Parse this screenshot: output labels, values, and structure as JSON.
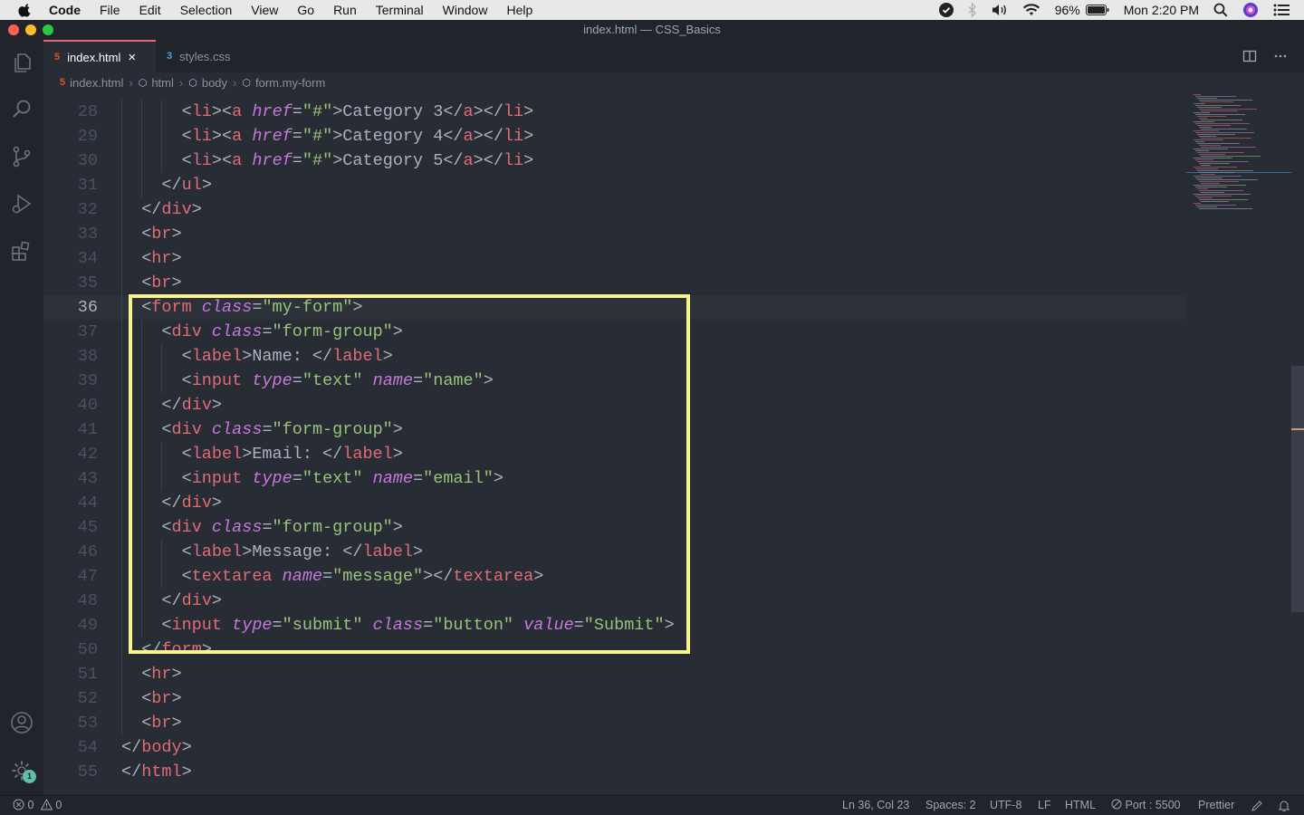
{
  "menubar": {
    "app": "Code",
    "items": [
      "File",
      "Edit",
      "Selection",
      "View",
      "Go",
      "Run",
      "Terminal",
      "Window",
      "Help"
    ],
    "battery": "96%",
    "clock": "Mon 2:20 PM"
  },
  "window": {
    "title": "index.html — CSS_Basics"
  },
  "tabs": [
    {
      "label": "index.html",
      "icon": "html5-icon",
      "active": true
    },
    {
      "label": "styles.css",
      "icon": "css3-icon",
      "active": false
    }
  ],
  "breadcrumb": [
    "index.html",
    "html",
    "body",
    "form.my-form"
  ],
  "editor": {
    "cursor_line": 36,
    "highlight_box": "form block lines 36-50",
    "lines": [
      {
        "n": "28"
      },
      {
        "n": "29"
      },
      {
        "n": "30"
      },
      {
        "n": "31"
      },
      {
        "n": "32"
      },
      {
        "n": "33"
      },
      {
        "n": "34"
      },
      {
        "n": "35"
      },
      {
        "n": "36"
      },
      {
        "n": "37"
      },
      {
        "n": "38"
      },
      {
        "n": "39"
      },
      {
        "n": "40"
      },
      {
        "n": "41"
      },
      {
        "n": "42"
      },
      {
        "n": "43"
      },
      {
        "n": "44"
      },
      {
        "n": "45"
      },
      {
        "n": "46"
      },
      {
        "n": "47"
      },
      {
        "n": "48"
      },
      {
        "n": "49"
      },
      {
        "n": "50"
      },
      {
        "n": "51"
      },
      {
        "n": "52"
      },
      {
        "n": "53"
      },
      {
        "n": "54"
      },
      {
        "n": "55"
      }
    ],
    "code": {
      "l28": [
        "<",
        "li",
        "><",
        "a",
        " ",
        "href",
        "=",
        "\"#\"",
        ">Category 3</",
        "a",
        "></",
        "li",
        ">"
      ],
      "l29": [
        "<",
        "li",
        "><",
        "a",
        " ",
        "href",
        "=",
        "\"#\"",
        ">Category 4</",
        "a",
        "></",
        "li",
        ">"
      ],
      "l30": [
        "<",
        "li",
        "><",
        "a",
        " ",
        "href",
        "=",
        "\"#\"",
        ">Category 5</",
        "a",
        "></",
        "li",
        ">"
      ],
      "l31": [
        "</",
        "ul",
        ">"
      ],
      "l32": [
        "</",
        "div",
        ">"
      ],
      "l33": [
        "<",
        "br",
        ">"
      ],
      "l34": [
        "<",
        "hr",
        ">"
      ],
      "l35": [
        "<",
        "br",
        ">"
      ],
      "l36": [
        "<",
        "form",
        " ",
        "class",
        "=",
        "\"my-form\"",
        ">"
      ],
      "l37": [
        "<",
        "div",
        " ",
        "class",
        "=",
        "\"form-group\"",
        ">"
      ],
      "l38": [
        "<",
        "label",
        ">Name: </",
        "label",
        ">"
      ],
      "l39": [
        "<",
        "input",
        " ",
        "type",
        "=",
        "\"text\"",
        " ",
        "name",
        "=",
        "\"name\"",
        ">"
      ],
      "l40": [
        "</",
        "div",
        ">"
      ],
      "l41": [
        "<",
        "div",
        " ",
        "class",
        "=",
        "\"form-group\"",
        ">"
      ],
      "l42": [
        "<",
        "label",
        ">Email: </",
        "label",
        ">"
      ],
      "l43": [
        "<",
        "input",
        " ",
        "type",
        "=",
        "\"text\"",
        " ",
        "name",
        "=",
        "\"email\"",
        ">"
      ],
      "l44": [
        "</",
        "div",
        ">"
      ],
      "l45": [
        "<",
        "div",
        " ",
        "class",
        "=",
        "\"form-group\"",
        ">"
      ],
      "l46": [
        "<",
        "label",
        ">Message: </",
        "label",
        ">"
      ],
      "l47": [
        "<",
        "textarea",
        " ",
        "name",
        "=",
        "\"message\"",
        "></",
        "textarea",
        ">"
      ],
      "l48": [
        "</",
        "div",
        ">"
      ],
      "l49": [
        "<",
        "input",
        " ",
        "type",
        "=",
        "\"submit\"",
        " ",
        "class",
        "=",
        "\"button\"",
        " ",
        "value",
        "=",
        "\"Submit\"",
        ">"
      ],
      "l50": [
        "</",
        "form",
        ">"
      ],
      "l51": [
        "<",
        "hr",
        ">"
      ],
      "l52": [
        "<",
        "br",
        ">"
      ],
      "l53": [
        "<",
        "br",
        ">"
      ],
      "l54": [
        "</",
        "body",
        ">"
      ],
      "l55": [
        "</",
        "html",
        ">"
      ]
    }
  },
  "statusbar": {
    "errors": "0",
    "warnings": "0",
    "position": "Ln 36, Col 23",
    "spaces": "Spaces: 2",
    "encoding": "UTF-8",
    "eol": "LF",
    "language": "HTML",
    "port": "Port : 5500",
    "formatter": "Prettier"
  },
  "activity": {
    "settings_badge": "1"
  },
  "colors": {
    "tag": "#e06c75",
    "attr": "#c678dd",
    "string": "#98c379",
    "highlight": "#fbf590",
    "background": "#282c34"
  }
}
